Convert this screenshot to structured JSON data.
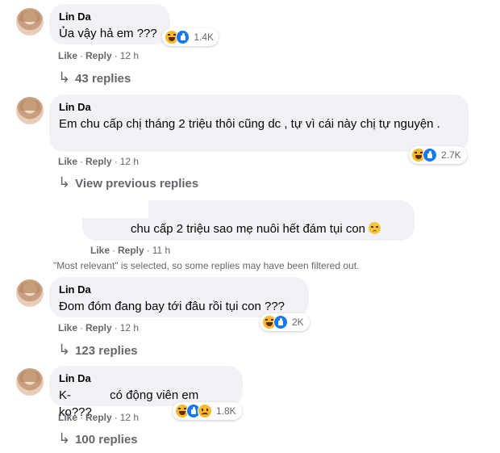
{
  "comments": [
    {
      "author": "Lin Da",
      "text": "Ủa vậy hả em ???",
      "like": "Like",
      "reply": "Reply",
      "time": "12 h",
      "reaction_count": "1.4K",
      "replies": "43 replies"
    },
    {
      "author": "Lin Da",
      "text": "Em chu cấp chị tháng 2 triệu thôi cũng dc , tự vì cái này chị tự nguyện .",
      "like": "Like",
      "reply": "Reply",
      "time": "12 h",
      "reaction_count": "2.7K",
      "view_previous": "View previous replies"
    },
    {
      "author": "Lin Da",
      "text": "Đom đóm đang bay tới đâu rồi tụi con ???",
      "like": "Like",
      "reply": "Reply",
      "time": "12 h",
      "reaction_count": "2K",
      "replies": "123 replies"
    },
    {
      "author": "Lin Da",
      "text_prefix": "K-",
      "text_suffix": "có động viên em ko???",
      "like": "Like",
      "reply": "Reply",
      "time": "12 h",
      "reaction_count": "1.8K",
      "replies": "100 replies"
    }
  ],
  "reply": {
    "text": "chu cấp 2 triệu sao mẹ nuôi hết đám tụi con",
    "emoji": "pensive-face",
    "like": "Like",
    "reply": "Reply",
    "time": "11 h"
  },
  "filter_note": "\"Most relevant\" is selected, so some replies may have been filtered out.",
  "dot": "·",
  "reply_arrow": "↳",
  "colors": {
    "bubble": "#f0f2f5",
    "secondary_text": "#65676b",
    "like_blue": "#1877f2",
    "haha_yellow": "#f7b928"
  },
  "icons": [
    "avatar",
    "haha-reaction-icon",
    "like-reaction-icon",
    "sad-reaction-icon",
    "reply-arrow-icon",
    "pensive-emoji-icon"
  ]
}
